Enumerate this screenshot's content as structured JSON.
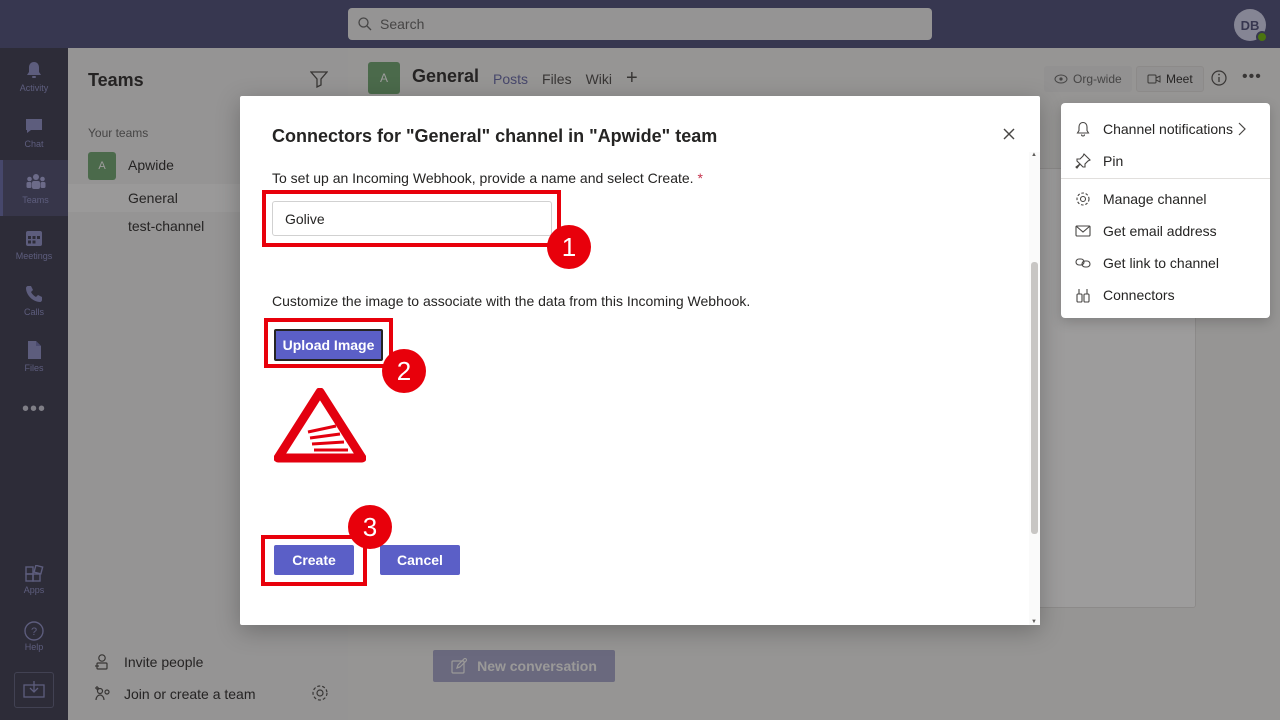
{
  "topbar": {
    "search_placeholder": "Search",
    "avatar_initials": "DB"
  },
  "rail": {
    "items": [
      {
        "label": "Activity",
        "icon": "bell-icon"
      },
      {
        "label": "Chat",
        "icon": "chat-icon"
      },
      {
        "label": "Teams",
        "icon": "teams-icon"
      },
      {
        "label": "Meetings",
        "icon": "calendar-icon"
      },
      {
        "label": "Calls",
        "icon": "phone-icon"
      },
      {
        "label": "Files",
        "icon": "file-icon"
      }
    ],
    "more": "•••",
    "bottom": [
      {
        "label": "Apps",
        "icon": "apps-icon"
      },
      {
        "label": "Help",
        "icon": "help-icon"
      }
    ]
  },
  "teams_panel": {
    "title": "Teams",
    "section": "Your teams",
    "team": {
      "initial": "A",
      "name": "Apwide"
    },
    "channels": [
      "General",
      "test-channel"
    ],
    "invite": "Invite people",
    "join": "Join or create a team"
  },
  "channel": {
    "initial": "A",
    "name": "General",
    "tabs": [
      "Posts",
      "Files",
      "Wiki",
      "+"
    ],
    "org_wide": "Org-wide",
    "meet": "Meet",
    "more": "•••",
    "new_conversation": "New conversation"
  },
  "menu": {
    "items": [
      {
        "label": "Channel notifications",
        "icon": "bell-icon"
      },
      {
        "label": "Pin",
        "icon": "pin-icon"
      },
      {
        "label": "Manage channel",
        "icon": "gear-icon"
      },
      {
        "label": "Get email address",
        "icon": "mail-icon"
      },
      {
        "label": "Get link to channel",
        "icon": "link-icon"
      },
      {
        "label": "Connectors",
        "icon": "connectors-icon"
      }
    ]
  },
  "dialog": {
    "title": "Connectors for \"General\" channel in \"Apwide\" team",
    "name_label": "To set up an Incoming Webhook, provide a name and select Create.",
    "required_mark": "*",
    "name_value": "Golive",
    "image_label": "Customize the image to associate with the data from this Incoming Webhook.",
    "upload_label": "Upload Image",
    "create_label": "Create",
    "cancel_label": "Cancel"
  },
  "annotations": [
    "1",
    "2",
    "3"
  ],
  "colors": {
    "brand": "#6264a7",
    "highlight": "#e8000b",
    "button": "#5b5fc7",
    "topbar": "#464775"
  }
}
